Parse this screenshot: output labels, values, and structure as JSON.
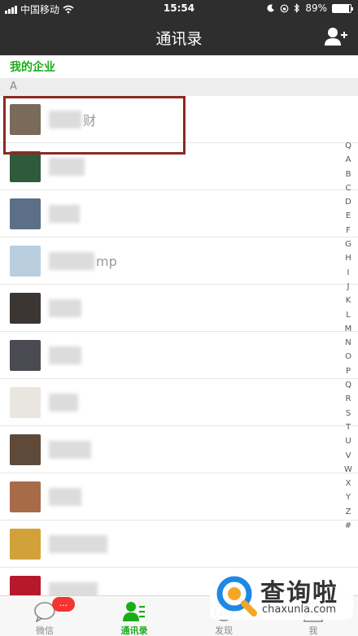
{
  "status_bar": {
    "carrier": "中国移动",
    "time": "15:54",
    "battery": "89%",
    "battery_level": 0.89
  },
  "nav": {
    "title": "通讯录",
    "add_contact_icon": "add-contact-icon"
  },
  "my_enterprise": "我的企业",
  "section_letter": "A",
  "contacts": [
    {
      "name_visible": "财",
      "avatar_color": "#7a6a5a"
    },
    {
      "name_visible": "",
      "avatar_color": "#2f5a3c"
    },
    {
      "name_visible": "",
      "avatar_color": "#5c6f88"
    },
    {
      "name_visible": "mp",
      "avatar_color": "#b9cfe0"
    },
    {
      "name_visible": "",
      "avatar_color": "#3b3633"
    },
    {
      "name_visible": "",
      "avatar_color": "#4a4a52"
    },
    {
      "name_visible": "",
      "avatar_color": "#e9e6df"
    },
    {
      "name_visible": "",
      "avatar_color": "#5f4a3a"
    },
    {
      "name_visible": "",
      "avatar_color": "#a86b4a"
    },
    {
      "name_visible": "",
      "avatar_color": "#d1a23a"
    },
    {
      "name_visible": "",
      "avatar_color": "#b5192b"
    }
  ],
  "index_letters": [
    "Q",
    "A",
    "B",
    "C",
    "D",
    "E",
    "F",
    "G",
    "H",
    "I",
    "J",
    "K",
    "L",
    "M",
    "N",
    "O",
    "P",
    "Q",
    "R",
    "S",
    "T",
    "U",
    "V",
    "W",
    "X",
    "Y",
    "Z",
    "#"
  ],
  "tabs": [
    {
      "label": "微信",
      "icon": "chat-icon",
      "badge": "..."
    },
    {
      "label": "通讯录",
      "icon": "contacts-icon",
      "active": true
    },
    {
      "label": "发现",
      "icon": "discover-icon"
    },
    {
      "label": "我",
      "icon": "me-icon"
    }
  ],
  "watermark": {
    "title": "查询啦",
    "url": "chaxunla.com"
  },
  "colors": {
    "nav_bg": "#2e2e2e",
    "accent_green": "#1aad19",
    "badge_red": "#f43530",
    "highlight_border": "#8b2a22"
  }
}
